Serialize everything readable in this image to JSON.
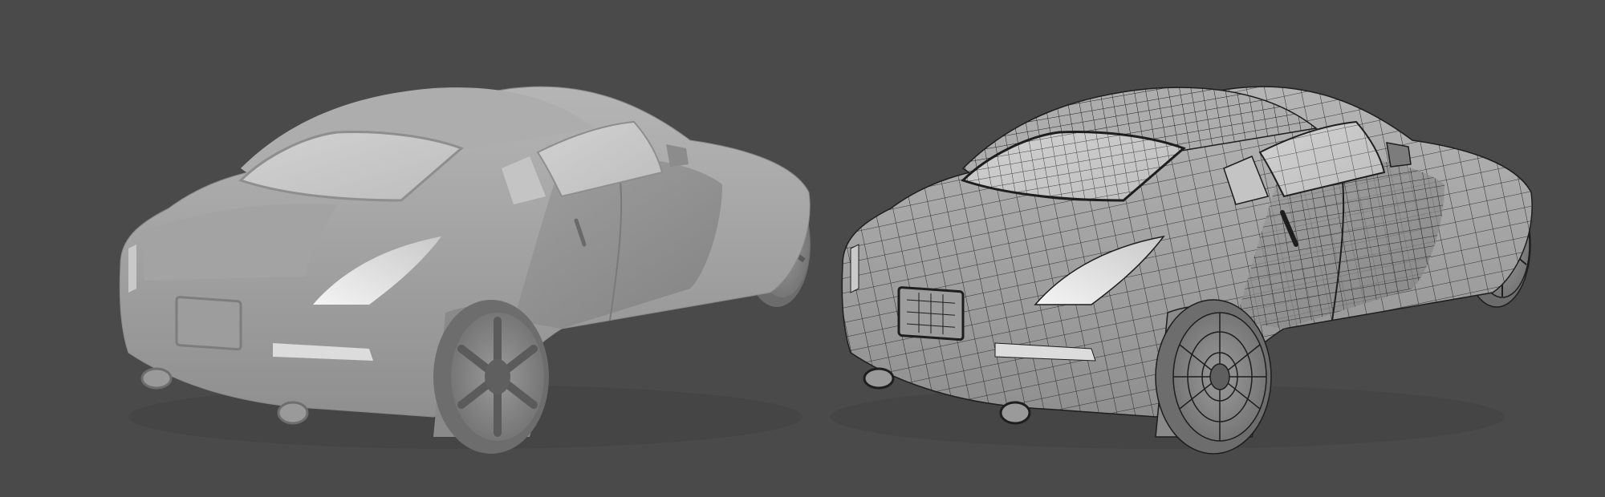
{
  "scene": {
    "background_color": "#4a4a4a",
    "models": [
      {
        "name": "shaded-car",
        "render_mode": "smooth-shaded",
        "color": "#a8a8a8"
      },
      {
        "name": "wireframe-car",
        "render_mode": "wireframe-on-shaded",
        "color": "#a8a8a8",
        "wire_color": "#1e1e1e"
      }
    ]
  }
}
